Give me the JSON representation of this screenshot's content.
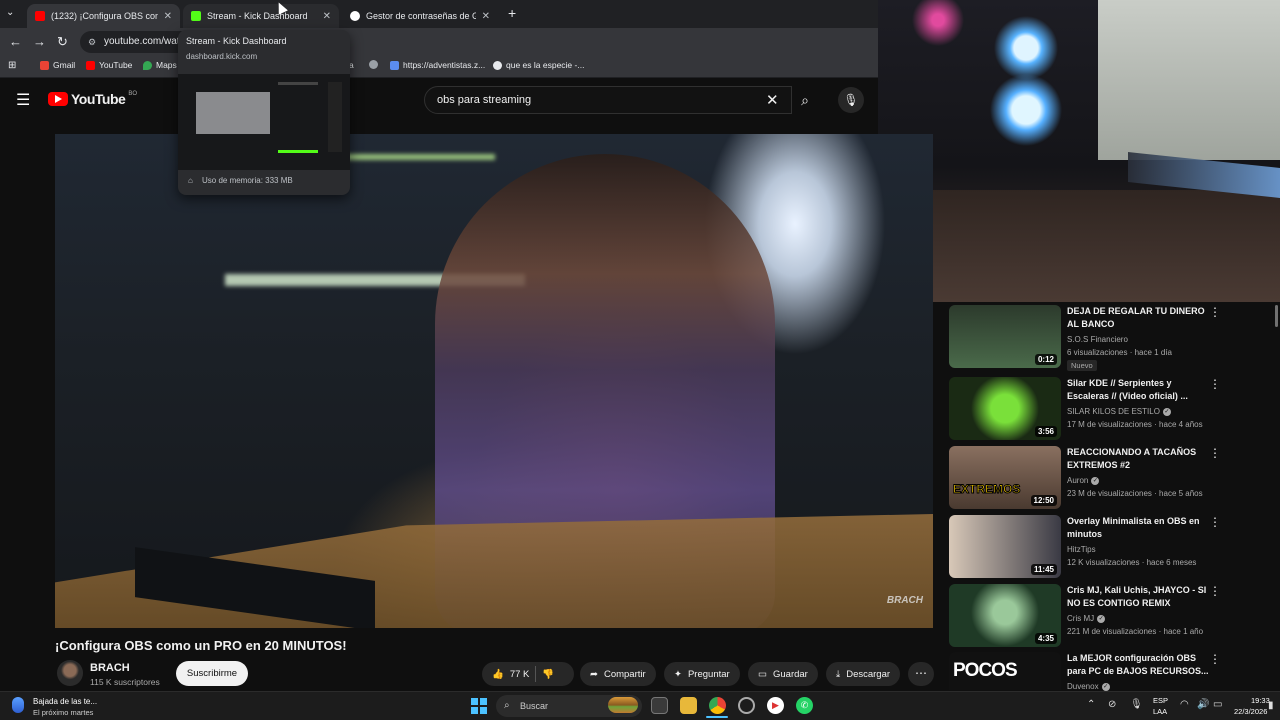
{
  "browser": {
    "tabs": [
      {
        "label": "(1232) ¡Configura OBS como u",
        "favicon_color": "#ff0000"
      },
      {
        "label": "Stream - Kick Dashboard",
        "favicon_color": "#53fc18"
      },
      {
        "label": "Gestor de contraseñas de Goog",
        "favicon_color": "#ffffff"
      }
    ],
    "new_tab": "+",
    "url": "youtube.com/wat",
    "bookmarks": [
      {
        "label": "Gmail",
        "color": "#ea4335"
      },
      {
        "label": "YouTube",
        "color": "#ff0000"
      },
      {
        "label": "Maps",
        "color": "#34a853"
      },
      {
        "label": "a",
        "color": "#9aa0a6"
      },
      {
        "label": "https://adventistas.z...",
        "color": "#5b8def"
      },
      {
        "label": "que es la especie -...",
        "color": "#e8eaed"
      }
    ],
    "hover_card": {
      "title": "Stream - Kick Dashboard",
      "url": "dashboard.kick.com",
      "memory": "Uso de memoria: 333 MB"
    }
  },
  "youtube": {
    "logo": "YouTube",
    "logo_cc": "BO",
    "search_query": "obs para streaming",
    "video": {
      "title": "¡Configura OBS como un PRO en 20 MINUTOS!",
      "watermark": "BRACH",
      "channel": "BRACH",
      "subscribers": "115 K suscriptores",
      "subscribe_label": "Suscribirme",
      "likes": "77 K",
      "share_label": "Compartir",
      "ask_label": "Preguntar",
      "save_label": "Guardar",
      "download_label": "Descargar"
    },
    "recommendations": [
      {
        "title": "DEJA DE REGALAR TU DINERO AL BANCO",
        "channel": "S.O.S Financiero",
        "meta": "6 visualizaciones · hace 1 día",
        "badge": "Nuevo",
        "duration": "0:12",
        "verified": false,
        "thumb_color": "#3d5a3a"
      },
      {
        "title": "Silar KDE // Serpientes y Escaleras // (Video oficial) ...",
        "channel": "SILAR KILOS DE ESTILO",
        "meta": "17 M de visualizaciones · hace 4 años",
        "badge": "",
        "duration": "3:56",
        "verified": true,
        "thumb_color": "#2f5a1c"
      },
      {
        "title": "REACCIONANDO A TACAÑOS EXTREMOS #2",
        "channel": "Auron",
        "meta": "23 M de visualizaciones · hace 5 años",
        "badge": "",
        "duration": "12:50",
        "verified": true,
        "thumb_color": "#6a5a4a"
      },
      {
        "title": "Overlay Minimalista en OBS en minutos",
        "channel": "HitzTips",
        "meta": "12 K visualizaciones · hace 6 meses",
        "badge": "",
        "duration": "11:45",
        "verified": false,
        "thumb_color": "#4a4448"
      },
      {
        "title": "Cris MJ, Kali Uchis, JHAYCO - SI NO ES CONTIGO REMIX",
        "channel": "Cris MJ",
        "meta": "221 M de visualizaciones · hace 1 año",
        "badge": "",
        "duration": "4:35",
        "verified": true,
        "thumb_color": "#1f3a26"
      },
      {
        "title": "La MEJOR configuración OBS para PC de BAJOS RECURSOS...",
        "channel": "Duvenox",
        "meta": "",
        "badge": "",
        "duration": "",
        "verified": true,
        "thumb_color": "#1a1a1a"
      }
    ]
  },
  "taskbar": {
    "weather_title": "Bajada de las te...",
    "weather_sub": "El próximo martes",
    "search_placeholder": "Buscar",
    "lang_line1": "ESP",
    "lang_line2": "LAA",
    "time": "19:33",
    "date": "22/3/2026"
  }
}
